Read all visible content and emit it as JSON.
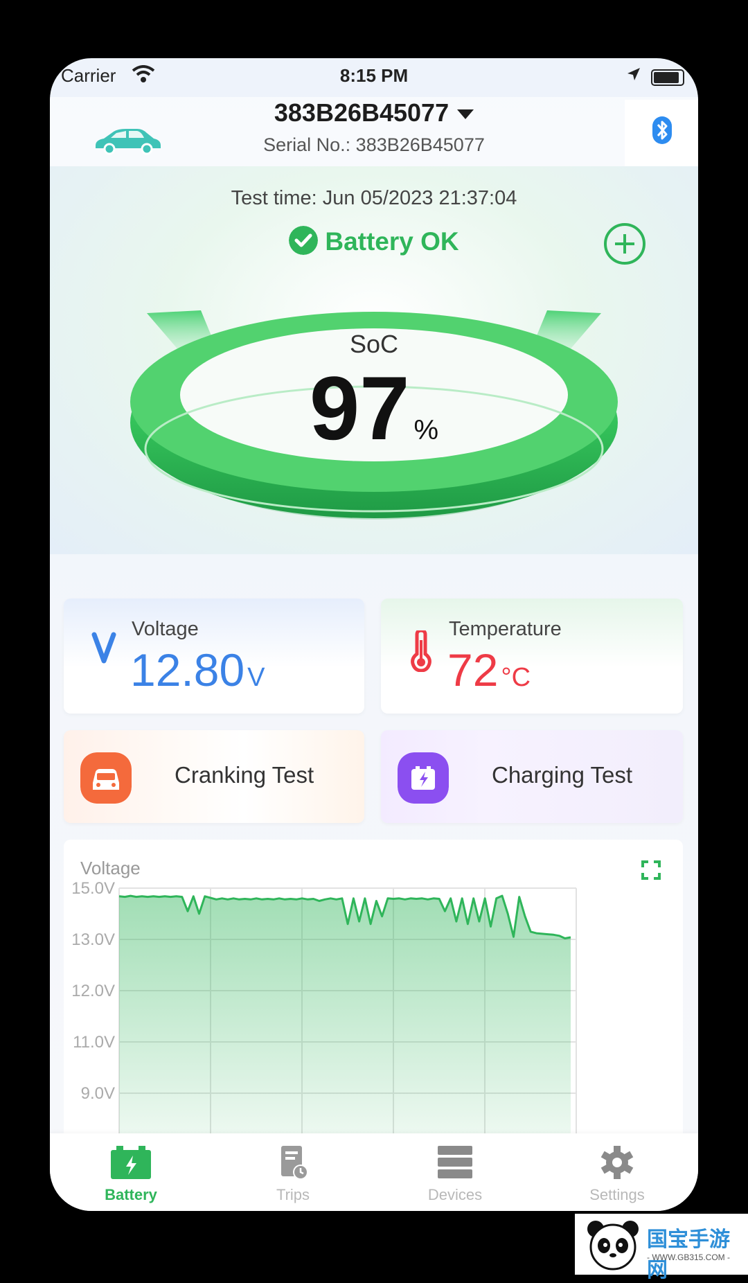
{
  "status_bar": {
    "carrier": "Carrier",
    "time": "8:15 PM"
  },
  "header": {
    "device_name": "383B26B45077",
    "serial": "Serial No.: 383B26B45077"
  },
  "hero": {
    "test_time": "Test time: Jun 05/2023 21:37:04",
    "status": "Battery OK",
    "soc_label": "SoC",
    "soc_value": "97",
    "soc_unit": "%"
  },
  "metrics": {
    "voltage": {
      "label": "Voltage",
      "value": "12.80",
      "unit": "V",
      "color": "#3b82e6"
    },
    "temperature": {
      "label": "Temperature",
      "value": "72",
      "unit": "°C",
      "color": "#ee3b46"
    }
  },
  "tests": {
    "cranking": "Cranking Test",
    "charging": "Charging Test"
  },
  "chart": {
    "title": "Voltage",
    "y_ticks": [
      "15.0V",
      "13.0V",
      "12.0V",
      "11.0V",
      "9.0V"
    ]
  },
  "chart_data": {
    "type": "area",
    "title": "Voltage",
    "ylabel": "",
    "y_tick_values": [
      15.0,
      13.0,
      12.0,
      11.0,
      9.0
    ],
    "x": [
      0,
      1,
      2,
      3,
      4,
      5,
      6,
      7,
      8,
      9,
      10,
      11,
      12,
      13,
      14,
      15,
      16,
      17,
      18,
      19,
      20,
      21,
      22,
      23,
      24,
      25,
      26,
      27,
      28,
      29,
      30,
      31,
      32,
      33,
      34,
      35,
      36,
      37,
      38,
      39,
      40,
      41,
      42,
      43,
      44,
      45,
      46,
      47,
      48,
      49,
      50,
      51,
      52,
      53,
      54,
      55,
      56,
      57,
      58,
      59,
      60,
      61,
      62,
      63,
      64,
      65,
      66,
      67,
      68,
      69,
      70,
      71,
      72,
      73,
      74,
      75,
      76,
      77,
      78,
      79
    ],
    "values": [
      14.68,
      14.66,
      14.7,
      14.66,
      14.68,
      14.66,
      14.68,
      14.66,
      14.68,
      14.66,
      14.68,
      14.66,
      14.1,
      14.68,
      14.0,
      14.68,
      14.62,
      14.56,
      14.6,
      14.56,
      14.6,
      14.56,
      14.58,
      14.56,
      14.6,
      14.56,
      14.58,
      14.56,
      14.6,
      14.56,
      14.58,
      14.56,
      14.6,
      14.56,
      14.58,
      14.5,
      14.56,
      14.6,
      14.56,
      14.6,
      13.6,
      14.6,
      13.7,
      14.6,
      13.6,
      14.5,
      13.9,
      14.6,
      14.58,
      14.6,
      14.56,
      14.6,
      14.58,
      14.6,
      14.56,
      14.6,
      14.58,
      14.1,
      14.6,
      13.7,
      14.6,
      13.6,
      14.6,
      13.7,
      14.6,
      13.5,
      14.6,
      14.7,
      14.0,
      13.1,
      14.66,
      13.9,
      13.3,
      13.24,
      13.22,
      13.2,
      13.18,
      13.14,
      13.04,
      13.08
    ],
    "ylim": [
      9.0,
      15.0
    ],
    "grid": true,
    "fill_color": "#2fb55a"
  },
  "tabs": [
    {
      "label": "Battery",
      "active": true
    },
    {
      "label": "Trips",
      "active": false
    },
    {
      "label": "Devices",
      "active": false
    },
    {
      "label": "Settings",
      "active": false
    }
  ],
  "watermark": {
    "text": "国宝手游网",
    "url": "- WWW.GB315.COM -"
  },
  "colors": {
    "accent": "#2fb55a",
    "voltage": "#3b82e6",
    "temperature": "#ee3b46"
  }
}
